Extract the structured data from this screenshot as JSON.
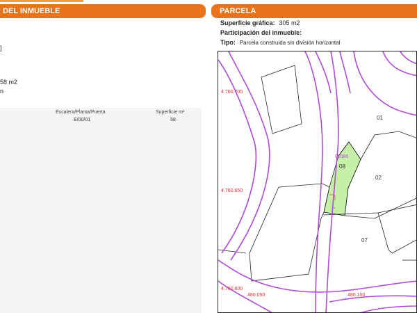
{
  "left_panel": {
    "header": "DEL INMUEBLE",
    "fragment_bracket": "]",
    "fragment_area": "58 m2",
    "fragment_n": "n",
    "table": {
      "columns": [
        "Escalera/Planta/Puerta",
        "Superficie m²"
      ],
      "rows": [
        [
          "E/00/01",
          "58"
        ]
      ]
    }
  },
  "right_panel": {
    "header": "PARCELA",
    "superficie_label": "Superficie gráfica:",
    "superficie_value": "305 m2",
    "participacion_label": "Participación del inmueble:",
    "participacion_value": "",
    "tipo_label": "Tipo:",
    "tipo_value": "Parcela construida sin división horizontal"
  },
  "map": {
    "coord_labels": [
      "4.760.700",
      "4.760.650",
      "4.760.600",
      "480.050",
      "480.100"
    ],
    "parcel_labels": [
      "01",
      "02",
      "07",
      "08"
    ],
    "road_label": "02080",
    "colors": {
      "road": "#b04ad8",
      "parcel_line": "#222222",
      "highlight": "#c6f0a8",
      "coords": "#d33333"
    }
  },
  "colors": {
    "header_bg": "#e8731a",
    "header_text": "#ffffff"
  }
}
